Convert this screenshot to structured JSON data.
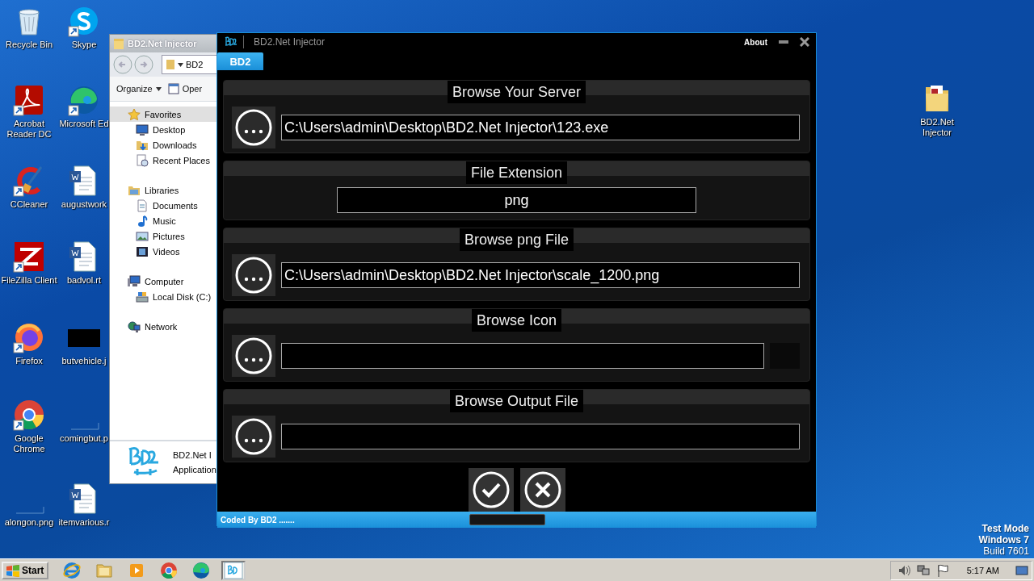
{
  "desktop": {
    "columns": [
      [
        {
          "label": "Recycle Bin",
          "kind": "recycle",
          "shortcut": false
        },
        {
          "label": "Acrobat Reader DC",
          "kind": "pdf",
          "shortcut": true
        },
        {
          "label": "CCleaner",
          "kind": "ccleaner",
          "shortcut": true
        },
        {
          "label": "FileZilla Client",
          "kind": "filezilla",
          "shortcut": true
        },
        {
          "label": "Firefox",
          "kind": "firefox",
          "shortcut": true
        },
        {
          "label": "Google Chrome",
          "kind": "chrome",
          "shortcut": true
        },
        {
          "label": "alongon.png",
          "kind": "image",
          "shortcut": false
        }
      ],
      [
        {
          "label": "Skype",
          "kind": "skype",
          "shortcut": true
        },
        {
          "label": "Microsoft Ed",
          "kind": "edge",
          "shortcut": true
        },
        {
          "label": "augustwork",
          "kind": "word",
          "shortcut": false
        },
        {
          "label": "badvol.rt",
          "kind": "word",
          "shortcut": false
        },
        {
          "label": "butvehicle.j",
          "kind": "image_dark",
          "shortcut": false
        },
        {
          "label": "comingbut.p",
          "kind": "image",
          "shortcut": false
        },
        {
          "label": "itemvarious.r",
          "kind": "word",
          "shortcut": false
        }
      ],
      [
        {
          "label": "BD2.Net Injector",
          "kind": "folder",
          "shortcut": false
        }
      ]
    ],
    "notice": [
      {
        "text": "Test Mode",
        "kind": "bold"
      },
      {
        "text": "Windows 7",
        "kind": "bold"
      },
      {
        "text": "Build 7601",
        "kind": "plain"
      }
    ]
  },
  "explorer": {
    "title": "BD2.Net Injector",
    "address": "BD2",
    "toolbar": [
      {
        "label": "Organize",
        "kind": "menu"
      },
      {
        "label": "Oper",
        "kind": "open"
      }
    ],
    "tree": [
      {
        "label": "Favorites",
        "kind": "star",
        "selected": true,
        "children": [
          {
            "label": "Desktop",
            "kind": "desktop",
            "selected": false
          },
          {
            "label": "Downloads",
            "kind": "downloads",
            "selected": false
          },
          {
            "label": "Recent Places",
            "kind": "recent",
            "selected": false
          }
        ]
      },
      {
        "label": "Libraries",
        "kind": "libraries",
        "selected": false,
        "children": [
          {
            "label": "Documents",
            "kind": "documents",
            "selected": false
          },
          {
            "label": "Music",
            "kind": "music",
            "selected": false
          },
          {
            "label": "Pictures",
            "kind": "pictures",
            "selected": false
          },
          {
            "label": "Videos",
            "kind": "videos",
            "selected": false
          }
        ]
      },
      {
        "label": "Computer",
        "kind": "computer",
        "selected": false,
        "children": [
          {
            "label": "Local Disk (C:)",
            "kind": "disk",
            "selected": false
          }
        ]
      },
      {
        "label": "Network",
        "kind": "network",
        "selected": false
      }
    ],
    "file": {
      "name": "BD2.Net I",
      "type": "Application"
    }
  },
  "app": {
    "title": "BD2.Net Injector",
    "about": "About",
    "tabs": [
      {
        "label": "BD2",
        "selected": true
      }
    ],
    "sections": [
      {
        "title": "Browse Your Server",
        "kind": "browse",
        "value": "C:\\Users\\admin\\Desktop\\BD2.Net Injector\\123.exe"
      },
      {
        "title": "File Extension",
        "kind": "text",
        "value": "png"
      },
      {
        "title": "Browse png File",
        "kind": "browse",
        "value": "C:\\Users\\admin\\Desktop\\BD2.Net Injector\\scale_1200.png"
      },
      {
        "title": "Browse Icon",
        "kind": "icon"
      },
      {
        "title": "Browse Output File",
        "kind": "browse"
      }
    ],
    "status": {
      "text": "Coded By BD2 .......",
      "progress": {
        "level": 0
      }
    }
  },
  "taskbar": {
    "start": "Start",
    "items": [
      {
        "kind": "ie",
        "selected": false
      },
      {
        "kind": "explorer",
        "selected": false
      },
      {
        "kind": "media",
        "selected": false
      },
      {
        "kind": "chrome",
        "selected": false
      },
      {
        "kind": "edge",
        "selected": false
      },
      {
        "kind": "injector",
        "selected": true
      }
    ],
    "tray": [
      {
        "kind": "volume"
      },
      {
        "kind": "network"
      },
      {
        "kind": "flag"
      }
    ],
    "clock": "5:17 AM"
  }
}
